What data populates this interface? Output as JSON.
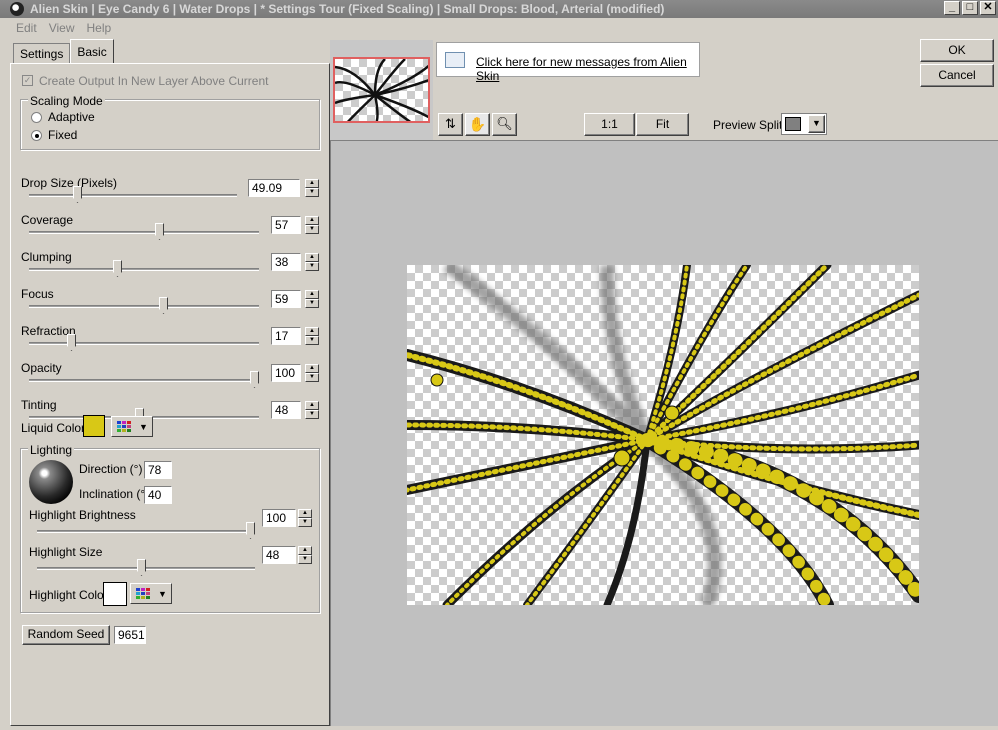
{
  "window": {
    "title": "Alien Skin | Eye Candy 6 | Water Drops | * Settings Tour (Fixed Scaling) | Small Drops: Blood, Arterial (modified)"
  },
  "menu": [
    "Edit",
    "View",
    "Help"
  ],
  "tabs": [
    "Settings",
    "Basic"
  ],
  "basic": {
    "create_output_label": "Create Output In New Layer Above Current",
    "scaling_mode": {
      "legend": "Scaling Mode",
      "options": [
        "Adaptive",
        "Fixed"
      ],
      "selected": "Fixed"
    },
    "sliders": [
      {
        "label": "Drop Size (Pixels)",
        "value": "49.09",
        "fraction": 0.22
      },
      {
        "label": "Coverage",
        "value": "57",
        "fraction": 0.57
      },
      {
        "label": "Clumping",
        "value": "38",
        "fraction": 0.38
      },
      {
        "label": "Focus",
        "value": "59",
        "fraction": 0.59
      },
      {
        "label": "Refraction",
        "value": "17",
        "fraction": 0.17
      },
      {
        "label": "Opacity",
        "value": "100",
        "fraction": 1.0
      },
      {
        "label": "Tinting",
        "value": "48",
        "fraction": 0.48
      }
    ],
    "liquid_color": {
      "label": "Liquid Color",
      "color": "#d8c816"
    },
    "lighting": {
      "legend": "Lighting",
      "direction_label": "Direction (°)",
      "direction_value": "78",
      "inclination_label": "Inclination (°)",
      "inclination_value": "40",
      "highlight_brightness": {
        "label": "Highlight Brightness",
        "value": "100",
        "fraction": 1.0
      },
      "highlight_size": {
        "label": "Highlight Size",
        "value": "48",
        "fraction": 0.48
      },
      "highlight_color": {
        "label": "Highlight Color",
        "color": "#ffffff"
      }
    },
    "random_seed": {
      "label": "Random Seed",
      "value": "9651"
    }
  },
  "preview": {
    "messages_link": "Click here for new messages from Alien Skin",
    "zoom_1to1": "1:1",
    "zoom_fit": "Fit",
    "preview_split_label": "Preview Split:"
  },
  "dialog": {
    "ok": "OK",
    "cancel": "Cancel"
  }
}
